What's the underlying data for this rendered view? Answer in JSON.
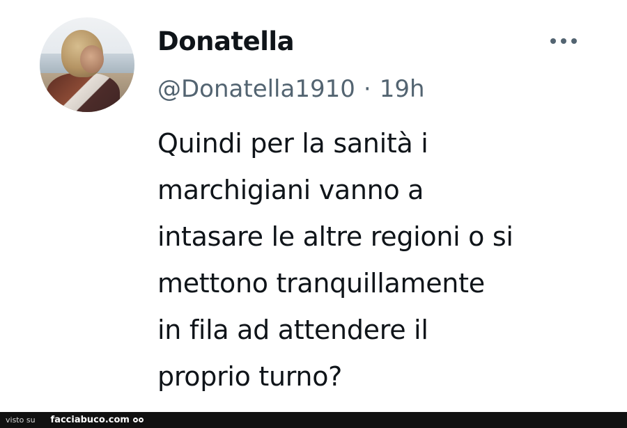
{
  "tweet": {
    "author": {
      "display_name": "Donatella",
      "handle": "@Donatella1910",
      "avatar_icon": "user-avatar-photo"
    },
    "separator": "·",
    "time_ago": "19h",
    "more_icon": "ellipsis-icon",
    "text": "Quindi per la sanità i\nmarchigiani vanno a\nintasare le altre regioni o si\nmettono tranquillamente\nin fila ad attendere il\nproprio turno?"
  },
  "footer": {
    "visto_label": "visto su",
    "site_label": "facciabuco.com",
    "logo_icon": "eyes-logo-icon"
  },
  "colors": {
    "text_primary": "#0f1419",
    "text_secondary": "#536471",
    "background": "#ffffff",
    "footer_background": "#111111"
  }
}
